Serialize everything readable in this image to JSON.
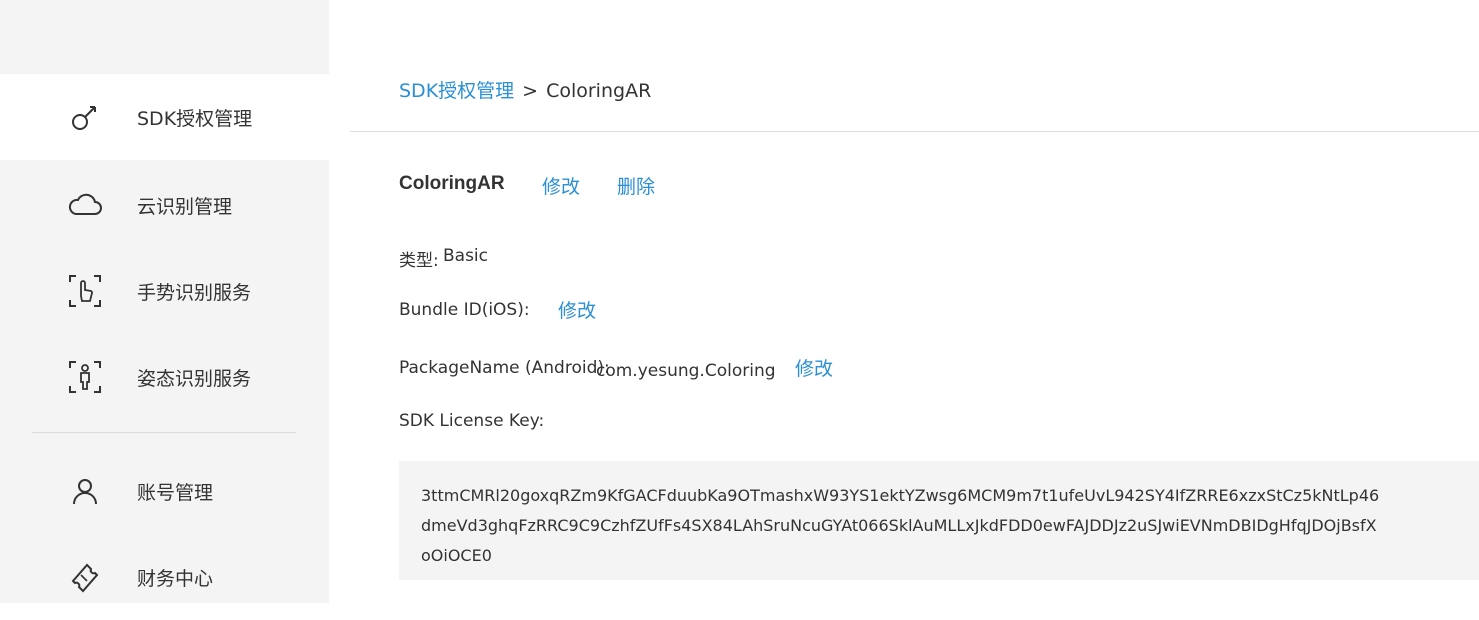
{
  "sidebar": {
    "items": [
      {
        "label": "SDK授权管理",
        "icon": "key-icon",
        "active": true
      },
      {
        "label": "云识别管理",
        "icon": "cloud-icon",
        "active": false
      },
      {
        "label": "手势识别服务",
        "icon": "hand-gesture-icon",
        "active": false
      },
      {
        "label": "姿态识别服务",
        "icon": "body-pose-icon",
        "active": false
      },
      {
        "label": "账号管理",
        "icon": "user-icon",
        "active": false
      },
      {
        "label": "财务中心",
        "icon": "ticket-icon",
        "active": false
      }
    ]
  },
  "breadcrumb": {
    "parent": "SDK授权管理",
    "separator": ">",
    "current": "ColoringAR"
  },
  "app": {
    "name": "ColoringAR",
    "edit_label": "修改",
    "delete_label": "删除"
  },
  "fields": {
    "type_label": "类型:",
    "type_value": "Basic",
    "bundle_label": "Bundle ID(iOS):",
    "bundle_edit": "修改",
    "package_label": "PackageName (Android):",
    "package_value": "com.yesung.Coloring",
    "package_edit": "修改",
    "license_label": "SDK License Key:",
    "license_key": "3ttmCMRl20goxqRZm9KfGACFduubKa9OTmashxW93YS1ektYZwsg6MCM9m7t1ufeUvL942SY4IfZRRE6xzxStCz5kNtLp46dmeVd3ghqFzRRC9C9CzhfZUfFs4SX84LAhSruNcuGYAt066SklAuMLLxJkdFDD0ewFAJDDJz2uSJwiEVNmDBIDgHfqJDOjBsfXoOiOCE0"
  },
  "colors": {
    "accent": "#2a8fd3",
    "sidebar_bg": "#f4f4f4",
    "active_bg": "#ffffff",
    "keybox_bg": "#f4f4f4"
  }
}
